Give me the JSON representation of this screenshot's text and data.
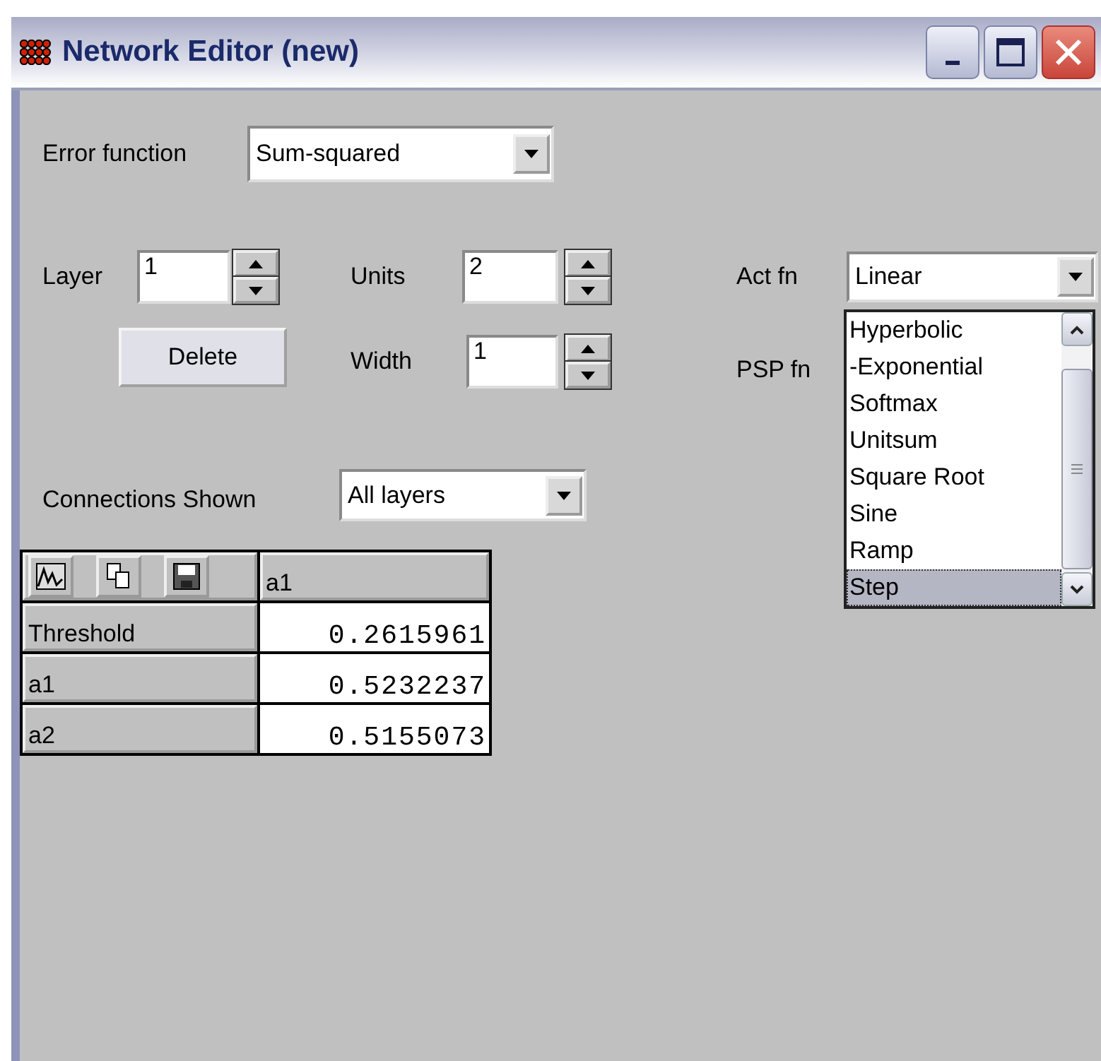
{
  "window": {
    "title": "Network Editor (new)"
  },
  "error_function": {
    "label": "Error function",
    "value": "Sum-squared"
  },
  "layer": {
    "label": "Layer",
    "value": "1"
  },
  "units": {
    "label": "Units",
    "value": "2"
  },
  "width": {
    "label": "Width",
    "value": "1"
  },
  "delete_button": "Delete",
  "act_fn": {
    "label": "Act fn",
    "value": "Linear",
    "expanded": true,
    "options": [
      {
        "label": "Hyperbolic",
        "selected": false
      },
      {
        "label": "-Exponential",
        "selected": false
      },
      {
        "label": "Softmax",
        "selected": false
      },
      {
        "label": "Unitsum",
        "selected": false
      },
      {
        "label": "Square Root",
        "selected": false
      },
      {
        "label": "Sine",
        "selected": false
      },
      {
        "label": "Ramp",
        "selected": false
      },
      {
        "label": "Step",
        "selected": true
      }
    ]
  },
  "psp_fn": {
    "label": "PSP fn"
  },
  "connections_shown": {
    "label": "Connections Shown",
    "value": "All layers"
  },
  "table": {
    "column_header": "a1",
    "rows": [
      {
        "label": "Threshold",
        "value": "0.2615961"
      },
      {
        "label": "a1",
        "value": "0.5232237"
      },
      {
        "label": "a2",
        "value": "0.5155073"
      }
    ]
  }
}
